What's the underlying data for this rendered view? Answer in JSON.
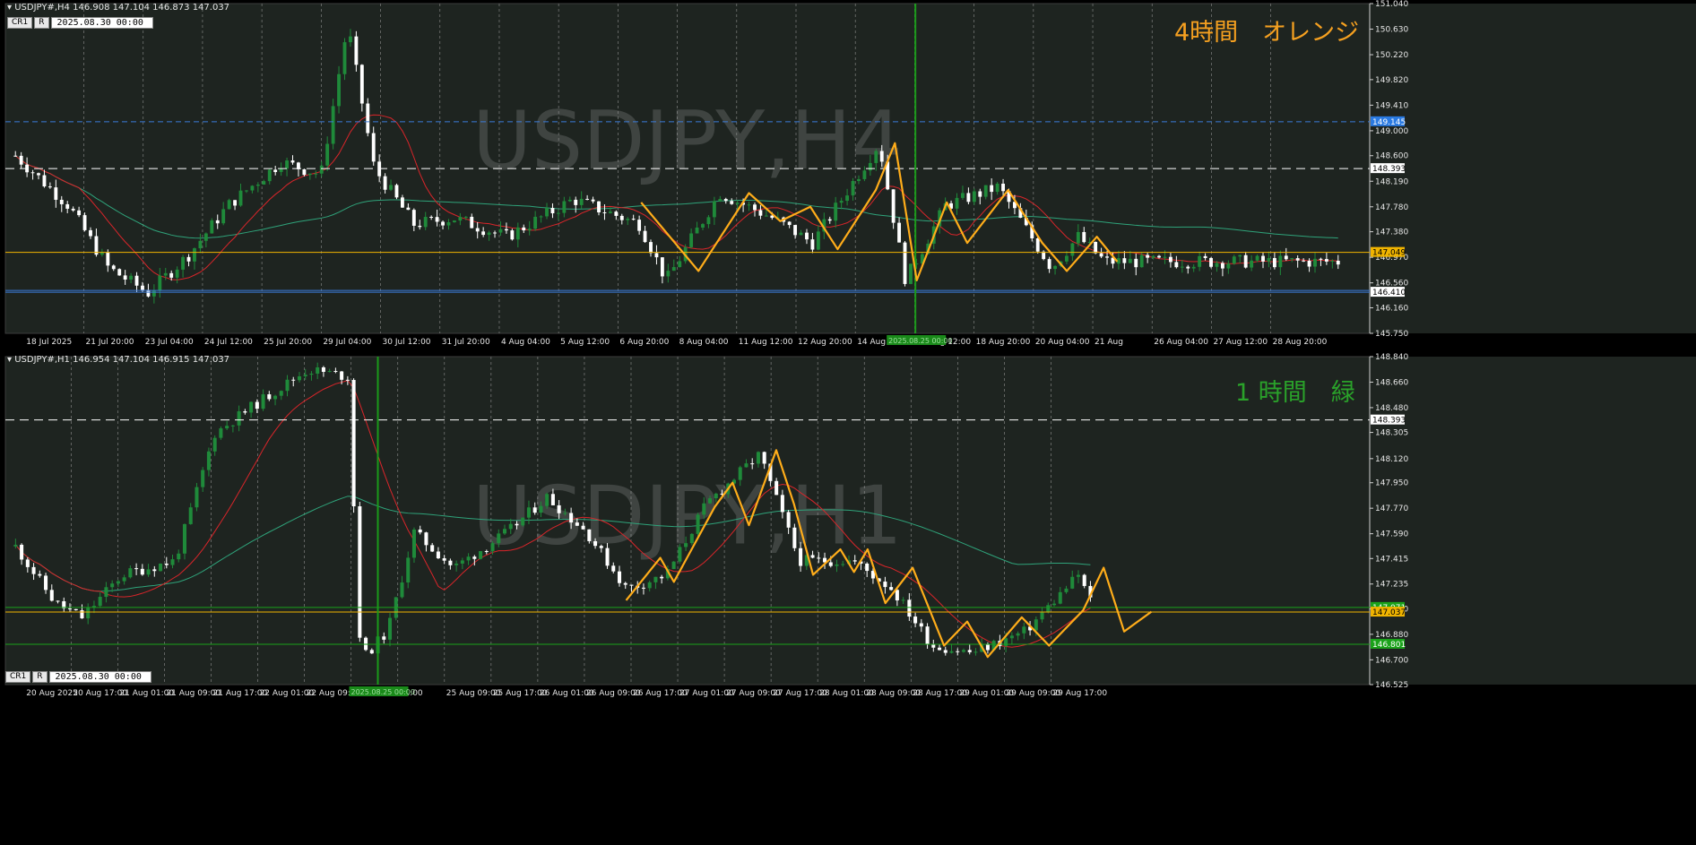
{
  "colors": {
    "background": "#1e2420",
    "grid": "#a8a8a8",
    "bull": "#1f8a3a",
    "bear": "#ffffff",
    "zigzag": "#ffad1a",
    "ma_fast": "#d9252a",
    "ma_slow": "#2fa37a",
    "price_line": "#f0b400",
    "blue_level": "#3b7bd8",
    "white_level": "#ffffff",
    "green_level": "#1aa21a",
    "vline": "#1a9a1a",
    "watermark": "#555a58",
    "title_h4": "#f5a020",
    "title_h1": "#2aa22a"
  },
  "chart_data": [
    {
      "type": "candlestick",
      "symbol": "USDJPY#,H4",
      "ohlc_label": "146.908 147.104 146.873 147.037",
      "watermark": "USDJPY,H4",
      "overlay_title": "4時間　オレンジ",
      "datetime_box": "2025.08.30 00:00",
      "ylim": [
        145.75,
        151.04
      ],
      "y_ticks": [
        "151.040",
        "150.630",
        "150.220",
        "149.820",
        "149.410",
        "149.000",
        "148.600",
        "148.190",
        "147.780",
        "147.380",
        "146.970",
        "146.560",
        "146.160",
        "145.750"
      ],
      "x_ticks": [
        "18 Jul 2025",
        "21 Jul 20:00",
        "23 Jul 04:00",
        "24 Jul 12:00",
        "25 Jul 20:00",
        "29 Jul 04:00",
        "30 Jul 12:00",
        "31 Jul 20:00",
        "4 Aug 04:00",
        "5 Aug 12:00",
        "6 Aug 20:00",
        "8 Aug 04:00",
        "11 Aug 12:00",
        "12 Aug 20:00",
        "14 Aug 04:00",
        "15 Aug 12:00",
        "18 Aug 20:00",
        "20 Aug 04:00",
        "21 Aug",
        "26 Aug 04:00",
        "27 Aug 12:00",
        "28 Aug 20:00"
      ],
      "vline_tag": "2025.08.25 00:00",
      "levels": {
        "blue_upper": {
          "value": 149.145,
          "label": "149.145"
        },
        "white_dashed": {
          "value": 148.393,
          "label": "148.393"
        },
        "price": {
          "value": 147.049,
          "label": "147.049"
        },
        "blue_lower": {
          "value": 146.41,
          "label": "146.410"
        }
      },
      "grid": true,
      "zigzag": [
        [
          0.466,
          147.85
        ],
        [
          0.508,
          146.75
        ],
        [
          0.545,
          148.0
        ],
        [
          0.568,
          147.55
        ],
        [
          0.59,
          147.78
        ],
        [
          0.61,
          147.1
        ],
        [
          0.638,
          148.05
        ],
        [
          0.652,
          148.8
        ],
        [
          0.668,
          146.6
        ],
        [
          0.69,
          147.85
        ],
        [
          0.705,
          147.2
        ],
        [
          0.735,
          148.05
        ],
        [
          0.76,
          147.2
        ],
        [
          0.778,
          146.75
        ],
        [
          0.8,
          147.3
        ],
        [
          0.815,
          146.9
        ]
      ]
    },
    {
      "type": "candlestick",
      "symbol": "USDJPY#,H1",
      "ohlc_label": "146.954 147.104 146.915 147.037",
      "watermark": "USDJPY,H1",
      "overlay_title": "1 時間　緑",
      "datetime_box": "2025.08.30 00:00",
      "ylim": [
        146.525,
        148.84
      ],
      "y_ticks": [
        "148.840",
        "148.660",
        "148.480",
        "148.305",
        "148.120",
        "147.950",
        "147.770",
        "147.590",
        "147.415",
        "147.235",
        "147.060",
        "146.880",
        "146.700",
        "146.525"
      ],
      "x_ticks": [
        "20 Aug 2025",
        "20 Aug 17:00",
        "21 Aug 01:00",
        "21 Aug 09:00",
        "21 Aug 17:00",
        "22 Aug 01:00",
        "22 Aug 09:00",
        "22",
        "01:00",
        "25 Aug 09:00",
        "25 Aug 17:00",
        "26 Aug 01:00",
        "26 Aug 09:00",
        "26 Aug 17:00",
        "27 Aug 01:00",
        "27 Aug 09:00",
        "27 Aug 17:00",
        "28 Aug 01:00",
        "28 Aug 09:00",
        "28 Aug 17:00",
        "29 Aug 01:00",
        "29 Aug 09:00",
        "29 Aug 17:00"
      ],
      "vline_tag": "2025.08.25 00:00",
      "levels": {
        "white_dashed": {
          "value": 148.393,
          "label": "148.393"
        },
        "green_upper": {
          "value": 147.07,
          "label": "147.071"
        },
        "price": {
          "value": 147.037,
          "label": "147.037"
        },
        "green_lower": {
          "value": 146.81,
          "label": "146.801"
        }
      },
      "grid": true,
      "zigzag": [
        [
          0.455,
          147.12
        ],
        [
          0.48,
          147.42
        ],
        [
          0.49,
          147.25
        ],
        [
          0.52,
          147.78
        ],
        [
          0.533,
          147.95
        ],
        [
          0.545,
          147.65
        ],
        [
          0.565,
          148.18
        ],
        [
          0.578,
          147.8
        ],
        [
          0.592,
          147.3
        ],
        [
          0.612,
          147.48
        ],
        [
          0.622,
          147.32
        ],
        [
          0.632,
          147.48
        ],
        [
          0.645,
          147.1
        ],
        [
          0.665,
          147.35
        ],
        [
          0.688,
          146.8
        ],
        [
          0.705,
          146.97
        ],
        [
          0.72,
          146.72
        ],
        [
          0.745,
          147.0
        ],
        [
          0.765,
          146.8
        ],
        [
          0.79,
          147.05
        ],
        [
          0.805,
          147.35
        ],
        [
          0.82,
          146.9
        ],
        [
          0.84,
          147.04
        ]
      ]
    }
  ],
  "buttons": {
    "cr1": "CR1",
    "r": "R"
  }
}
